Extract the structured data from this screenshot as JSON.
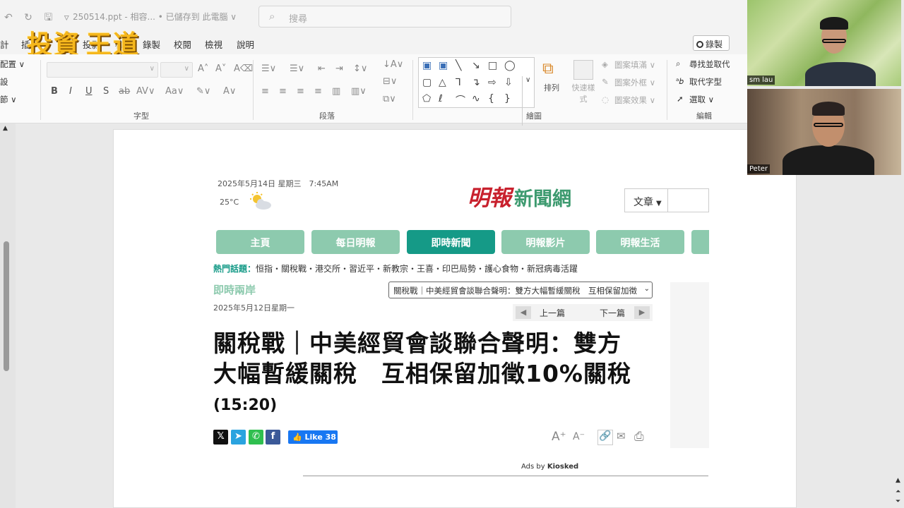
{
  "titlebar": {
    "icons": "↶ ↻ 🖫 ▿",
    "filename": "250514.ppt - 相容... • 已儲存到 此電腦 ∨",
    "search_placeholder": "搜尋"
  },
  "logo": {
    "part1": "投資",
    "part2": "王道"
  },
  "menu": {
    "items": [
      "計",
      "插",
      "投影",
      "檢",
      "錄製",
      "校閱",
      "檢視",
      "說明"
    ]
  },
  "record_label": "錄製",
  "ribbon": {
    "arrange_left": "配置 ∨",
    "left_row2": "設",
    "left_row3": "節 ∨",
    "font_group": "字型",
    "paragraph_group": "段落",
    "drawing_group": "繪圖",
    "editing_group": "編輯",
    "arrange_label": "排列",
    "quick_styles_label": "快速樣式",
    "shape_fill": "圖案填滿 ∨",
    "shape_outline": "圖案外框 ∨",
    "shape_effects": "圖案效果 ∨",
    "find_replace": "尋找並取代",
    "replace_font": "取代字型",
    "select": "選取 ∨"
  },
  "webpage": {
    "date": "2025年5月14日 星期三　7:45AM",
    "temperature": "25°C",
    "brand_name": "明報",
    "brand_sub": "新聞網",
    "category_select": "文章",
    "nav_tabs": [
      "主頁",
      "每日明報",
      "即時新聞",
      "明報影片",
      "明報生活",
      ""
    ],
    "hot_label": "熱門話題：",
    "hot_topics": "恒指・關稅戰・港交所・習近平・新教宗・王喜・印巴局勢・護心食物・新冠病毒活躍",
    "section": "即時兩岸",
    "article_select": "關稅戰｜中美經貿會談聯合聲明：雙方大幅暫緩關稅　互相保留加徵",
    "article_date": "2025年5月12日星期一",
    "prev": "上一篇",
    "next": "下一篇",
    "headline_line1": "關稅戰｜中美經貿會談聯合聲明：雙方",
    "headline_line2": "大幅暫緩關稅　互相保留加徵10%關稅",
    "time": "(15:20)",
    "like_label": "Like 38",
    "ads_prefix": "Ads by ",
    "ads_brand": "Kiosked"
  },
  "video": {
    "person1": "sm lau",
    "person2": "Peter"
  },
  "colors": {
    "brand_red": "#c8202d",
    "brand_green": "#3d9a6f",
    "nav_active": "#159a87",
    "nav_tab": "#8dcaae",
    "logo_gold": "#f5b71c"
  }
}
